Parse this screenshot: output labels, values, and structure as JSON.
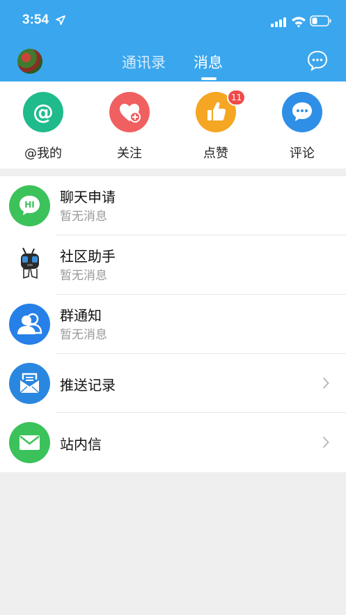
{
  "status": {
    "time": "3:54"
  },
  "nav": {
    "tabs": [
      {
        "label": "通讯录"
      },
      {
        "label": "消息"
      }
    ],
    "active_tab": "消息"
  },
  "quick": {
    "items": [
      {
        "label": "@我的",
        "icon": "at-icon",
        "color": "#1fbb8c"
      },
      {
        "label": "关注",
        "icon": "heart-plus-icon",
        "color": "#f06060"
      },
      {
        "label": "点赞",
        "icon": "thumbs-up-icon",
        "color": "#f5a623"
      },
      {
        "label": "评论",
        "icon": "comment-icon",
        "color": "#2f8fe6"
      }
    ],
    "likes_badge": "11"
  },
  "list": {
    "items": [
      {
        "title": "聊天申请",
        "subtitle": "暂无消息",
        "icon": "chat-request-icon",
        "color": "#3cc25a"
      },
      {
        "title": "社区助手",
        "subtitle": "暂无消息",
        "icon": "robot-icon",
        "color": "#ffffff"
      },
      {
        "title": "群通知",
        "subtitle": "暂无消息",
        "icon": "group-icon",
        "color": "#2680e8"
      },
      {
        "title": "推送记录",
        "subtitle": "",
        "icon": "mail-tray-icon",
        "color": "#2a87e0"
      },
      {
        "title": "站内信",
        "subtitle": "",
        "icon": "envelope-icon",
        "color": "#3cc25a"
      }
    ]
  }
}
